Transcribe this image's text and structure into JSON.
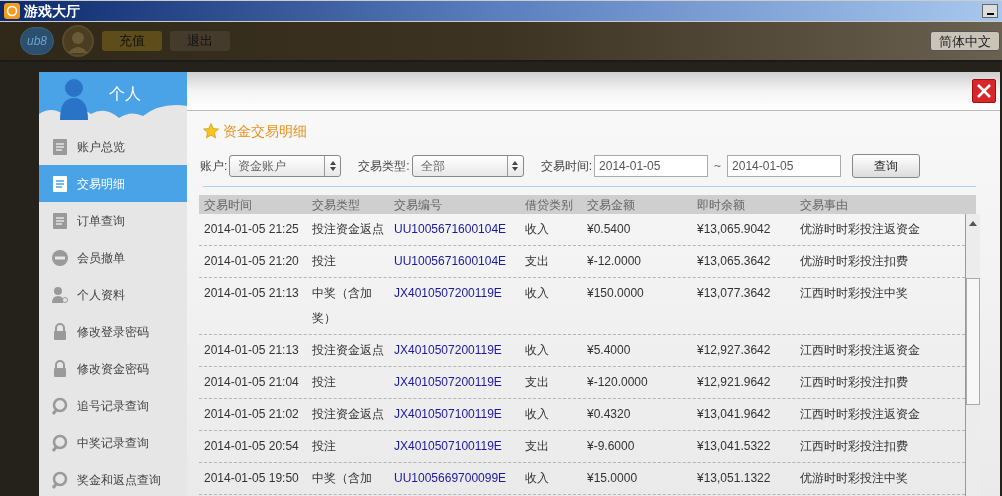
{
  "window": {
    "title": "游戏大厅"
  },
  "header": {
    "logo": "ub8",
    "buttons": [
      "充值",
      "退出"
    ],
    "language": "简体中文"
  },
  "sidebar": {
    "title": "个人",
    "items": [
      {
        "label": "账户总览",
        "selected": false
      },
      {
        "label": "交易明细",
        "selected": true
      },
      {
        "label": "订单查询",
        "selected": false
      },
      {
        "label": "会员撤单",
        "selected": false
      },
      {
        "label": "个人资料",
        "selected": false
      },
      {
        "label": "修改登录密码",
        "selected": false
      },
      {
        "label": "修改资金密码",
        "selected": false
      },
      {
        "label": "追号记录查询",
        "selected": false
      },
      {
        "label": "中奖记录查询",
        "selected": false
      },
      {
        "label": "奖金和返点查询",
        "selected": false
      }
    ]
  },
  "panel": {
    "title": "资金交易明细",
    "filters": {
      "account": {
        "label": "账户:",
        "value": "资金账户"
      },
      "type": {
        "label": "交易类型:",
        "value": "全部"
      },
      "date": {
        "label": "交易时间:",
        "from": "2014-01-05",
        "separator": "~",
        "to": "2014-01-05"
      },
      "button": "查询"
    },
    "table": {
      "columns": [
        "交易时间",
        "交易类型",
        "交易编号",
        "借贷类别",
        "交易金额",
        "即时余额",
        "交易事由"
      ],
      "rows": [
        [
          "2014-01-05 21:25",
          "投注资金返点",
          "UU1005671600104E",
          "收入",
          "¥0.5400",
          "¥13,065.9042",
          "优游时时彩投注返资金"
        ],
        [
          "2014-01-05 21:20",
          "投注",
          "UU1005671600104E",
          "支出",
          "¥-12.0000",
          "¥13,065.3642",
          "优游时时彩投注扣费"
        ],
        [
          "2014-01-05 21:13",
          "中奖（含加奖）",
          "JX4010507200119E",
          "收入",
          "¥150.0000",
          "¥13,077.3642",
          "江西时时彩投注中奖"
        ],
        [
          "2014-01-05 21:13",
          "投注资金返点",
          "JX4010507200119E",
          "收入",
          "¥5.4000",
          "¥12,927.3642",
          "江西时时彩投注返资金"
        ],
        [
          "2014-01-05 21:04",
          "投注",
          "JX4010507200119E",
          "支出",
          "¥-120.0000",
          "¥12,921.9642",
          "江西时时彩投注扣费"
        ],
        [
          "2014-01-05 21:02",
          "投注资金返点",
          "JX4010507100119E",
          "收入",
          "¥0.4320",
          "¥13,041.9642",
          "江西时时彩投注返资金"
        ],
        [
          "2014-01-05 20:54",
          "投注",
          "JX4010507100119E",
          "支出",
          "¥-9.6000",
          "¥13,041.5322",
          "江西时时彩投注扣费"
        ],
        [
          "2014-01-05 19:50",
          "中奖（含加",
          "UU1005669700099E",
          "收入",
          "¥15.0000",
          "¥13,051.1322",
          "优游时时彩投注中奖"
        ]
      ]
    }
  }
}
